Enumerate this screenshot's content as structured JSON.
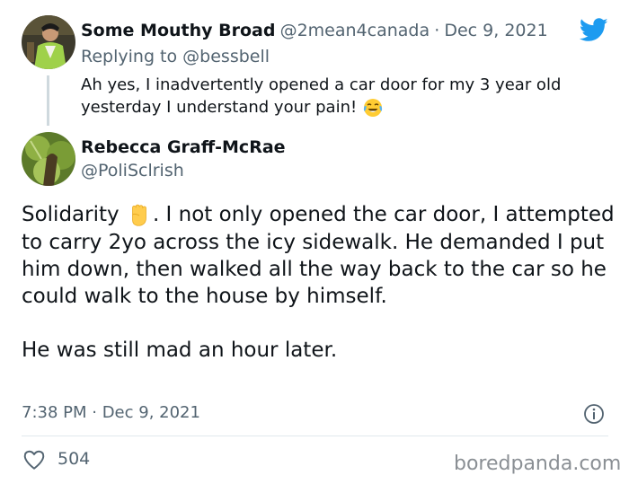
{
  "reply": {
    "author_name": "Some Mouthy Broad",
    "handle": "@2mean4canada",
    "separator": "·",
    "date": "Dec 9, 2021",
    "replying_prefix": "Replying to",
    "replying_to": "@bessbell",
    "text_line1": "Ah yes, I inadvertently opened a car door for my 3 year old",
    "text_line2": "yesterday I understand your pain!",
    "emoji": "face-with-tears-of-joy"
  },
  "main": {
    "author_name": "Rebecca Graff-McRae",
    "handle": "@PoliSclrish",
    "text_start": "Solidarity ",
    "emoji": "raised-fist",
    "text_rest": ". I not only opened the car door, I attempted to carry 2yo across the icy sidewalk. He demanded I put him down, then walked all the way back to the car so he could walk to the house by himself.",
    "text_second": "He was still mad an hour later.",
    "timestamp": "7:38 PM · Dec 9, 2021",
    "likes": "504"
  },
  "watermark": "boredpanda.com",
  "colors": {
    "twitter_blue": "#1d9bf0",
    "muted_text": "#536471",
    "divider": "#e1e8ed"
  }
}
